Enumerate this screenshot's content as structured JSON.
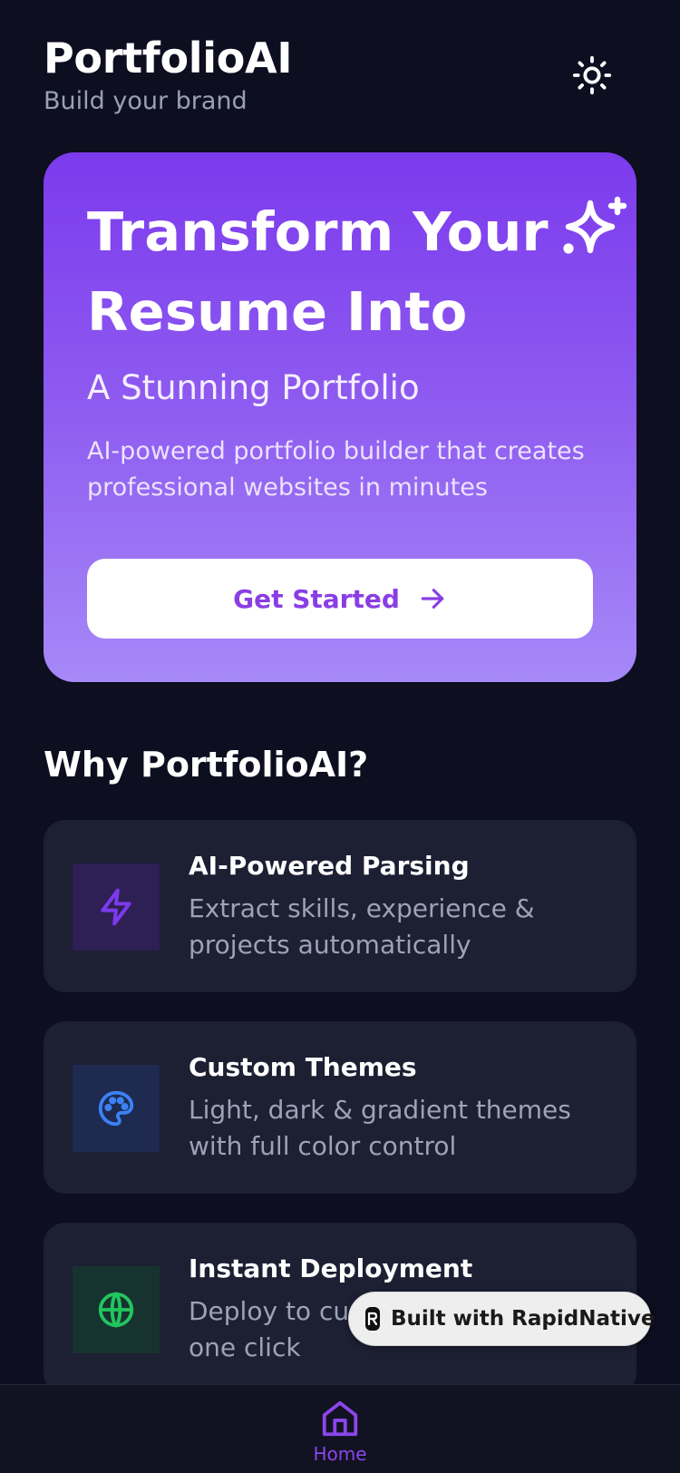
{
  "header": {
    "title": "PortfolioAI",
    "subtitle": "Build your brand",
    "theme_icon": "sun-icon"
  },
  "hero": {
    "title_line1": "Transform Your",
    "title_line2": "Resume Into",
    "subtitle": "A Stunning Portfolio",
    "description": "AI-powered portfolio builder that creates professional websites in minutes",
    "cta_label": "Get Started",
    "cta_icon": "arrow-right-icon",
    "sparkle_icon": "sparkles-icon",
    "gradient_top": "#7c3aed",
    "gradient_bottom": "#a689f8"
  },
  "features_section": {
    "title": "Why PortfolioAI?",
    "items": [
      {
        "title": "AI-Powered Parsing",
        "description": "Extract skills, experience & projects automatically",
        "icon": "lightning-icon",
        "accent": "#7c3aed"
      },
      {
        "title": "Custom Themes",
        "description": "Light, dark & gradient themes with full color control",
        "icon": "palette-icon",
        "accent": "#3b82f6"
      },
      {
        "title": "Instant Deployment",
        "description": "Deploy to custom domain with one click",
        "icon": "globe-icon",
        "accent": "#22c55e"
      }
    ]
  },
  "badge": {
    "label": "Built with RapidNative"
  },
  "bottom_nav": {
    "items": [
      {
        "label": "Home",
        "icon": "home-icon",
        "active": true
      }
    ]
  }
}
